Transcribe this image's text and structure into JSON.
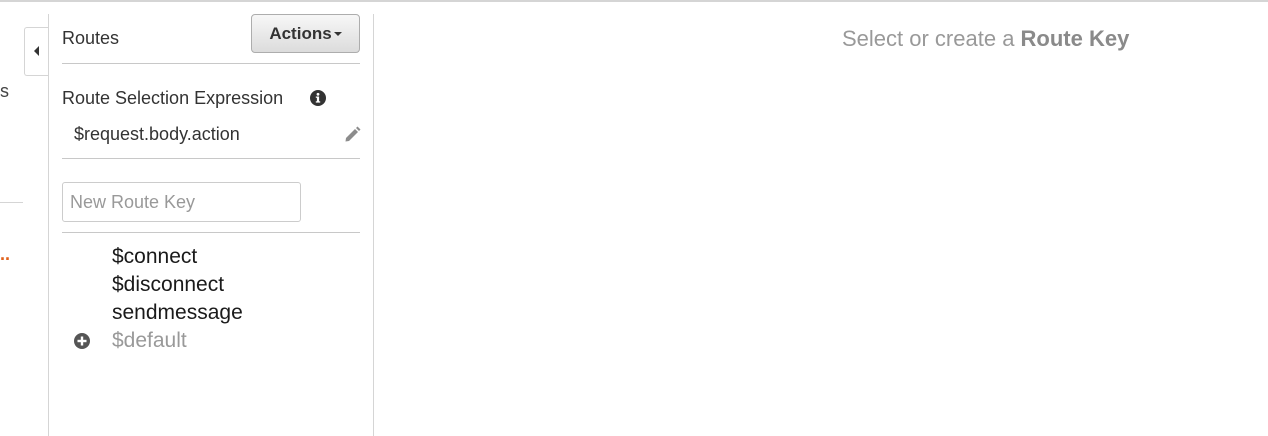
{
  "left_nav": {
    "partial_item_text": "s",
    "partial_active_text": ".."
  },
  "routes_panel": {
    "title": "Routes",
    "actions_label": "Actions",
    "route_selection_expression": {
      "label": "Route Selection Expression",
      "value": "$request.body.action"
    },
    "new_route_key": {
      "placeholder": "New Route Key",
      "value": ""
    },
    "routes": [
      {
        "key": "$connect"
      },
      {
        "key": "$disconnect"
      },
      {
        "key": "sendmessage"
      },
      {
        "key": "$default"
      }
    ]
  },
  "main": {
    "empty_message_prefix": "Select or create a ",
    "empty_message_emphasis": "Route Key"
  },
  "colors": {
    "accent_orange": "#e0601c",
    "muted_text": "#999999",
    "border": "#d5d5d5"
  },
  "icons": [
    "collapse-left-icon",
    "info-icon",
    "pencil-icon",
    "plus-circle-icon",
    "caret-down-icon"
  ]
}
